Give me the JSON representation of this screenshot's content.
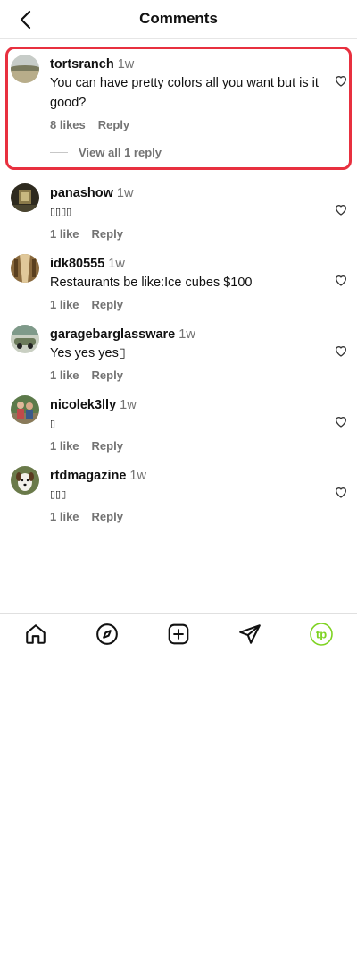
{
  "header": {
    "title": "Comments",
    "back_icon": "chevron-left-icon"
  },
  "comments": [
    {
      "username": "tortsranch",
      "time": "1w",
      "text": "You can have pretty colors all you want but is it good?",
      "likes": "8 likes",
      "reply": "Reply",
      "view_replies": "View all 1 reply",
      "avatar": "landscape-avatar",
      "highlighted": true
    },
    {
      "username": "panashow",
      "time": "1w",
      "text": "▯▯▯▯",
      "likes": "1 like",
      "reply": "Reply",
      "avatar": "dark-room-avatar"
    },
    {
      "username": "idk80555",
      "time": "1w",
      "text": "Restaurants be like:Ice cubes $100",
      "likes": "1 like",
      "reply": "Reply",
      "avatar": "hallway-avatar"
    },
    {
      "username": "garagebarglassware",
      "time": "1w",
      "text": "Yes yes yes▯",
      "likes": "1 like",
      "reply": "Reply",
      "avatar": "car-avatar"
    },
    {
      "username": "nicolek3lly",
      "time": "1w",
      "text": "▯",
      "likes": "1 like",
      "reply": "Reply",
      "avatar": "people-avatar"
    },
    {
      "username": "rtdmagazine",
      "time": "1w",
      "text": "▯▯▯",
      "likes": "1 like",
      "reply": "Reply",
      "avatar": "dog-avatar"
    }
  ],
  "nav": {
    "items": [
      "home-icon",
      "explore-compass-icon",
      "create-plus-icon",
      "direct-send-icon",
      "profile-tp-icon"
    ],
    "profile_initials": "tp",
    "profile_color": "#7ed321"
  },
  "colors": {
    "highlight": "#e8303f",
    "muted": "#737373"
  }
}
